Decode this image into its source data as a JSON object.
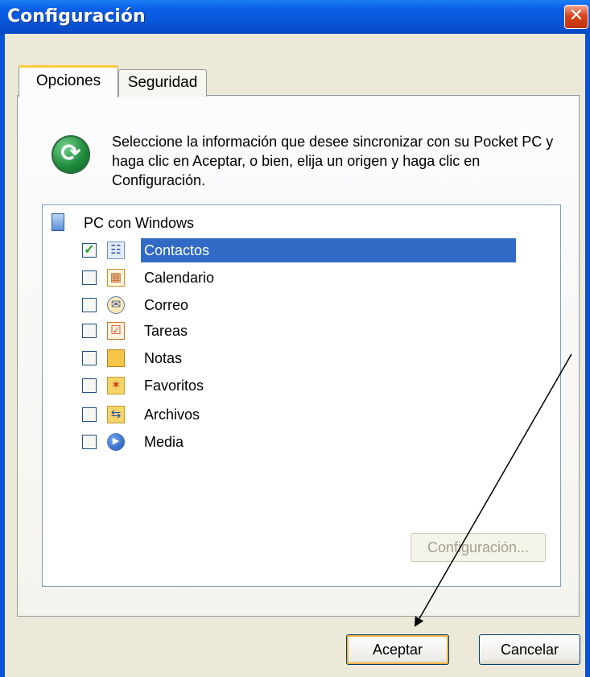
{
  "window": {
    "title": "Configuración",
    "close_glyph": "✕"
  },
  "tabs": [
    {
      "label": "Opciones",
      "active": true
    },
    {
      "label": "Seguridad",
      "active": false
    }
  ],
  "intro": {
    "icon": "sync-icon",
    "text": "Seleccione la información que desee sincronizar con su Pocket PC y haga clic en Aceptar, o bien, elija un origen y haga clic en Configuración."
  },
  "tree": {
    "root": {
      "label": "PC con Windows",
      "icon": "computer-icon"
    },
    "items": [
      {
        "label": "Contactos",
        "checked": true,
        "selected": true,
        "icon": "contacts-icon"
      },
      {
        "label": "Calendario",
        "checked": false,
        "icon": "calendar-icon"
      },
      {
        "label": "Correo",
        "checked": false,
        "icon": "mail-icon"
      },
      {
        "label": "Tareas",
        "checked": false,
        "icon": "tasks-icon"
      },
      {
        "label": "Notas",
        "checked": false,
        "icon": "notes-icon"
      },
      {
        "label": "Favoritos",
        "checked": false,
        "icon": "favorites-folder-icon"
      },
      {
        "label": "Archivos",
        "checked": false,
        "icon": "files-sync-icon"
      },
      {
        "label": "Media",
        "checked": false,
        "icon": "media-player-icon"
      }
    ]
  },
  "buttons": {
    "configure": "Configuración...",
    "ok": "Aceptar",
    "cancel": "Cancelar"
  },
  "colors": {
    "title_bar": "#0a58dc",
    "selection": "#316ac5",
    "dialog_bg": "#ece9d8"
  }
}
